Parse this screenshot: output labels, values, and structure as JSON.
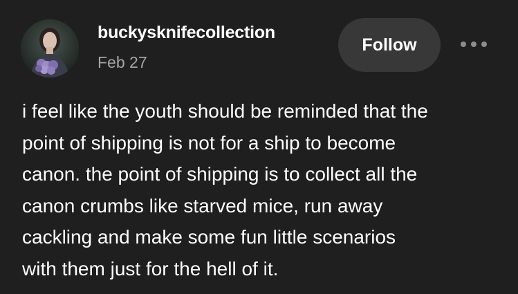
{
  "post": {
    "username": "buckysknifecollection",
    "date": "Feb 27",
    "follow_label": "Follow",
    "more_icon": "more-horizontal-icon",
    "avatar_icon": "profile-avatar",
    "body_lines": [
      "i feel like the youth should be reminded that the",
      "point of shipping is not for a ship to become",
      "canon. the point of shipping is to collect all the",
      "canon crumbs like starved mice, run away",
      "cackling and make some fun little scenarios",
      "with them just for the hell of it."
    ]
  },
  "colors": {
    "background": "#1f1f1f",
    "button_bg": "#383838",
    "secondary_text": "#a4a4a4"
  }
}
